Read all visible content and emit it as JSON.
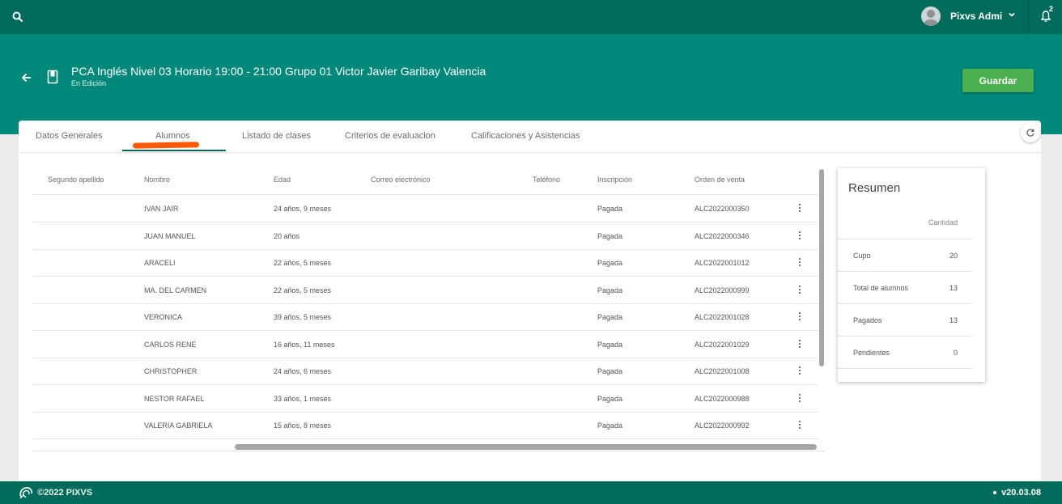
{
  "topbar": {
    "search_icon": "search-icon",
    "user_name": "Pixvs Admi",
    "notifications_count": "2"
  },
  "header": {
    "title": "PCA Inglés Nivel 03 Horario 19:00 - 21:00 Grupo 01 Victor Javier Garibay Valencia",
    "subtitle": "En Edición",
    "save_label": "Guardar"
  },
  "tabs": [
    {
      "label": "Datos Generales"
    },
    {
      "label": "Alumnos"
    },
    {
      "label": "Listado de clases"
    },
    {
      "label": "Criterios de evaluacion"
    },
    {
      "label": "Calificaciones y Asistencias"
    }
  ],
  "table": {
    "columns": [
      "Segundo apellido",
      "Nombre",
      "Edad",
      "Correo electrónico",
      "Teléfono",
      "Inscripción",
      "Orden de venta"
    ],
    "rows": [
      {
        "segundo_apellido": "",
        "nombre": "IVAN JAIR",
        "edad": "24 años, 9 meses",
        "correo": "",
        "telefono": "",
        "inscripcion": "Pagada",
        "orden": "ALC2022000350"
      },
      {
        "segundo_apellido": "",
        "nombre": "JUAN MANUEL",
        "edad": "20 años",
        "correo": "",
        "telefono": "",
        "inscripcion": "Pagada",
        "orden": "ALC2022000346"
      },
      {
        "segundo_apellido": "",
        "nombre": "ARACELI",
        "edad": "22 años, 5 meses",
        "correo": "",
        "telefono": "",
        "inscripcion": "Pagada",
        "orden": "ALC2022001012"
      },
      {
        "segundo_apellido": "",
        "nombre": "MA. DEL CARMEN",
        "edad": "22 años, 5 meses",
        "correo": "",
        "telefono": "",
        "inscripcion": "Pagada",
        "orden": "ALC2022000999"
      },
      {
        "segundo_apellido": "",
        "nombre": "VERONICA",
        "edad": "39 años, 5 meses",
        "correo": "",
        "telefono": "",
        "inscripcion": "Pagada",
        "orden": "ALC2022001028"
      },
      {
        "segundo_apellido": "",
        "nombre": "CARLOS RENE",
        "edad": "16 años, 11 meses",
        "correo": "",
        "telefono": "",
        "inscripcion": "Pagada",
        "orden": "ALC2022001029"
      },
      {
        "segundo_apellido": "",
        "nombre": "CHRISTOPHER",
        "edad": "24 años, 6 meses",
        "correo": "",
        "telefono": "",
        "inscripcion": "Pagada",
        "orden": "ALC2022001008"
      },
      {
        "segundo_apellido": "",
        "nombre": "NESTOR RAFAEL",
        "edad": "33 años, 1 meses",
        "correo": "",
        "telefono": "",
        "inscripcion": "Pagada",
        "orden": "ALC2022000988"
      },
      {
        "segundo_apellido": "",
        "nombre": "VALERIA GABRIELA",
        "edad": "15 años, 8 meses",
        "correo": "",
        "telefono": "",
        "inscripcion": "Pagada",
        "orden": "ALC2022000992"
      }
    ]
  },
  "summary": {
    "title": "Resumen",
    "column_header": "Cantidad",
    "items": [
      {
        "label": "Cupo",
        "value": "20"
      },
      {
        "label": "Total de alumnos",
        "value": "13"
      },
      {
        "label": "Pagados",
        "value": "13"
      },
      {
        "label": "Pendientes",
        "value": "0"
      }
    ]
  },
  "footer": {
    "copyright": "©2022 PIXVS",
    "version": "v20.03.08"
  },
  "colors": {
    "topbar": "#006b5b",
    "header": "#00897b",
    "accent_button": "#4caf50",
    "tab_highlight": "#ff5a00"
  }
}
